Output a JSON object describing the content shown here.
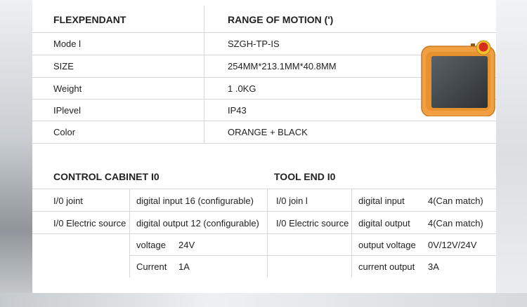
{
  "spec_table": {
    "header": {
      "left": "FLEXPENDANT",
      "right": "RANGE OF MOTION (')"
    },
    "rows": [
      {
        "label": "Mode l",
        "value": "SZGH-TP-IS"
      },
      {
        "label": "SIZE",
        "value": "254MM*213.1MM*40.8MM"
      },
      {
        "label": "Weight",
        "value": "1 .0KG"
      },
      {
        "label": "IPlevel",
        "value": "IP43"
      },
      {
        "label": "Color",
        "value": "ORANGE + BLACK"
      }
    ]
  },
  "control_cabinet": {
    "title": "CONTROL CABINET I0",
    "rows": [
      {
        "label": "I/0 joint",
        "sub": "digital input 16 (configurable)",
        "val": ""
      },
      {
        "label": "I/0 Electric source",
        "sub": "digital output 12 (configurable)",
        "val": ""
      },
      {
        "label": "",
        "sub": "voltage",
        "val": "24V"
      },
      {
        "label": "",
        "sub": "Current",
        "val": "1A"
      }
    ]
  },
  "tool_end": {
    "title": "TOOL END I0",
    "rows": [
      {
        "label": "I/0 join l",
        "sub": "digital input",
        "val": "4(Can match)"
      },
      {
        "label": "I/0 Electric source",
        "sub": "digital output",
        "val": "4(Can match)"
      },
      {
        "label": "",
        "sub": "output voltage",
        "val": "0V/12V/24V"
      },
      {
        "label": "",
        "sub": "current output",
        "val": "3A"
      }
    ]
  },
  "colors": {
    "pendant_body": "#f0a040",
    "pendant_screen": "#3d4246",
    "estop": "#d62b1f"
  }
}
